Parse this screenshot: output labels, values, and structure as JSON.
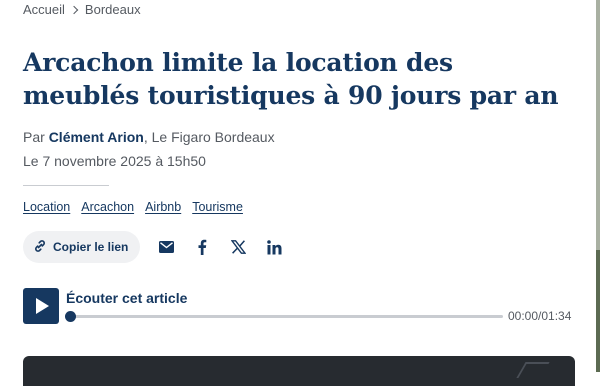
{
  "breadcrumb": {
    "home": "Accueil",
    "section": "Bordeaux"
  },
  "article": {
    "title": "Arcachon limite la location des meublés touristiques à 90 jours par an",
    "byline_prefix": "Par",
    "author": "Clément Arion",
    "publication": ", Le Figaro Bordeaux",
    "date": "Le 7 novembre 2025 à 15h50"
  },
  "tags": [
    "Location",
    "Arcachon",
    "Airbnb",
    "Tourisme"
  ],
  "share": {
    "copy_label": "Copier le lien",
    "icons": [
      "mail-icon",
      "facebook-icon",
      "x-icon",
      "linkedin-icon"
    ]
  },
  "audio": {
    "title": "Écouter cet article",
    "time": "00:00/01:34",
    "progress": 0
  },
  "colors": {
    "primary": "#163860",
    "muted": "#555a61",
    "chip_bg": "#f0f1f3"
  }
}
